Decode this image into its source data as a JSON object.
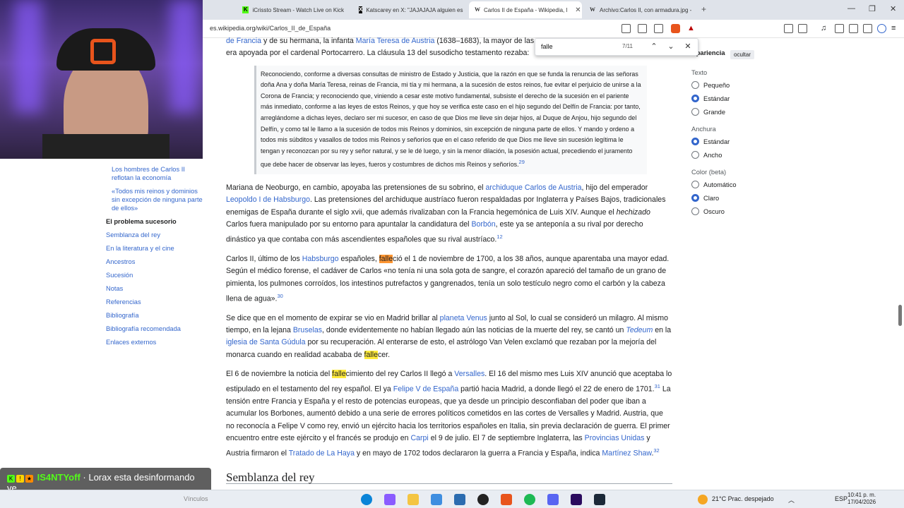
{
  "browser": {
    "tabs": [
      {
        "label": "iCrissto Stream - Watch Live on Kick",
        "icon": "kick-icon",
        "active": false
      },
      {
        "label": "Katscarey en X: \"JAJAJAJA alguien es",
        "icon": "x-icon",
        "active": false
      },
      {
        "label": "Carlos II de España - Wikipedia, l",
        "icon": "wikipedia-icon",
        "active": true
      },
      {
        "label": "Archivo:Carlos II, con armadura.jpg -",
        "icon": "wikipedia-icon",
        "active": false
      }
    ],
    "url": "es.wikipedia.org/wiki/Carlos_II_de_España"
  },
  "find": {
    "query": "falle",
    "count": "7/11"
  },
  "toc": {
    "sub_items": [
      "Los hombres de Carlos II reflotan la economía",
      "«Todos mis reinos y dominios sin excepción de ninguna parte de ellos»"
    ],
    "current": "El problema sucesorio",
    "items": [
      "Semblanza del rey",
      "En la literatura y el cine",
      "Ancestros",
      "Sucesión",
      "Notas",
      "Referencias",
      "Bibliografía",
      "Bibliografía recomendada",
      "Enlaces externos"
    ]
  },
  "article": {
    "p0": {
      "a": "de Francia",
      "b": " y de su hermana, la infanta ",
      "c": "María Teresa de Austria",
      "d": " (1638–1683), la mayor de las ",
      "e": "era apoyada por el cardenal Portocarrero. La cláusula 13 del susodicho testamento rezaba:"
    },
    "quote": "Reconociendo, conforme a diversas consultas de ministro de Estado y Justicia, que la razón en que se funda la renuncia de las señoras doña Ana y doña María Teresa, reinas de Francia, mi tía y mi hermana, a la sucesión de estos reinos, fue evitar el perjuicio de unirse a la Corona de Francia; y reconociendo que, viniendo a cesar este motivo fundamental, subsiste el derecho de la sucesión en el pariente más inmediato, conforme a las leyes de estos Reinos, y que hoy se verifica este caso en el hijo segundo del Delfín de Francia: por tanto, arreglándome a dichas leyes, declaro ser mi sucesor, en caso de que Dios me lleve sin dejar hijos, al Duque de Anjou, hijo segundo del Delfín, y como tal le llamo a la sucesión de todos mis Reinos y dominios, sin excepción de ninguna parte de ellos. Y mando y ordeno a todos mis súbditos y vasallos de todos mis Reinos y señoríos que en el caso referido de que Dios me lleve sin sucesión legítima le tengan y reconozcan por su rey y señor natural, y se le dé luego, y sin la menor dilación, la posesión actual, precediendo el juramento que debe hacer de observar las leyes, fueros y costumbres de dichos mis Reinos y señoríos.",
    "quote_ref": "29",
    "p1": {
      "a": "Mariana de Neoburgo, en cambio, apoyaba las pretensiones de su sobrino, el ",
      "b": "archiduque Carlos de Austria",
      "c": ", hijo del emperador ",
      "d": "Leopoldo I de Habsburgo",
      "e": ". Las pretensiones del archiduque austríaco fueron respaldadas por Inglaterra y Países Bajos, tradicionales enemigas de España durante el siglo xvii, que además rivalizaban con la Francia hegemónica de Luis XIV. Aunque el ",
      "f": "hechizado",
      "g": " Carlos fuera manipulado por su entorno para apuntalar la candidatura del ",
      "h": "Borbón",
      "i": ", este ya se anteponía a su rival por derecho dinástico ya que contaba con más ascendientes españoles que su rival austríaco.",
      "ref": "12"
    },
    "p2": {
      "a": "Carlos II, último de los ",
      "b": "Habsburgo",
      "c": " españoles, ",
      "d": "falle",
      "e": "ció el 1 de noviembre de 1700, a los 38 años, aunque aparentaba una mayor edad. Según el médico forense, el cadáver de Carlos «no tenía ni una sola gota de sangre, el corazón apareció del tamaño de un grano de pimienta, los pulmones corroídos, los intestinos putrefactos y gangrenados, tenía un solo testículo negro como el carbón y la cabeza llena de agua».",
      "ref": "30"
    },
    "p3": {
      "a": "Se dice que en el momento de expirar se vio en Madrid brillar al ",
      "b": "planeta Venus",
      "c": " junto al Sol, lo cual se consideró un milagro. Al mismo tiempo, en la lejana ",
      "d": "Bruselas",
      "e": ", donde evidentemente no habían llegado aún las noticias de la muerte del rey, se cantó un ",
      "f": "Tedeum",
      "g": " en la ",
      "h": "iglesia de Santa Gúdula",
      "i": " por su recuperación. Al enterarse de esto, el astrólogo Van Velen exclamó que rezaban por la mejoría del monarca cuando en realidad acababa de ",
      "j": "falle",
      "k": "cer."
    },
    "p4": {
      "a": "El 6 de noviembre la noticia del ",
      "b": "falle",
      "c": "cimiento del rey Carlos II llegó a ",
      "d": "Versalles",
      "e": ". El 16 del mismo mes Luis XIV anunció que aceptaba lo estipulado en el testamento del rey español. El ya ",
      "f": "Felipe V de España",
      "g": " partió hacia Madrid, a donde llegó el 22 de enero de 1701.",
      "ref1": "31",
      "h": " La tensión entre Francia y España y el resto de potencias europeas, que ya desde un principio desconfiaban del poder que iban a acumular los Borbones, aumentó debido a una serie de errores políticos cometidos en las cortes de Versalles y Madrid. Austria, que no reconocía a Felipe V como rey, envió un ejército hacia los territorios españoles en Italia, sin previa declaración de guerra. El primer encuentro entre este ejército y el francés se produjo en ",
      "i": "Carpi",
      "j": " el 9 de julio. El 7 de septiembre Inglaterra, las ",
      "k": "Provincias Unidas",
      "l": " y Austria firmaron el ",
      "m": "Tratado de La Haya",
      "n": " y en mayo de 1702 todos declararon la guerra a Francia y España, indica ",
      "o": "Martínez Shaw",
      "ref2": "32"
    },
    "next_heading": "Semblanza del rey"
  },
  "appearance": {
    "title": "Apariencia",
    "hide_label": "ocultar",
    "text_group": "Texto",
    "text_options": [
      "Pequeño",
      "Estándar",
      "Grande"
    ],
    "width_group": "Anchura",
    "width_options": [
      "Estándar",
      "Ancho"
    ],
    "color_group": "Color (beta)",
    "color_options": [
      "Automático",
      "Claro",
      "Oscuro"
    ]
  },
  "chat": {
    "username": "IS4NTYoff",
    "message": "· Lorax esta desinformando ve"
  },
  "taskbar": {
    "search_text": "Vínculos",
    "weather": "21°C  Prac. despejado",
    "lang": "ESP",
    "time": "10:41 p. m.",
    "date": "17/04/2026"
  },
  "colors": {
    "link": "#3366cc",
    "highlight": "#ffeb3b",
    "highlight_active": "#ff9632",
    "kick_green": "#53fc18"
  }
}
